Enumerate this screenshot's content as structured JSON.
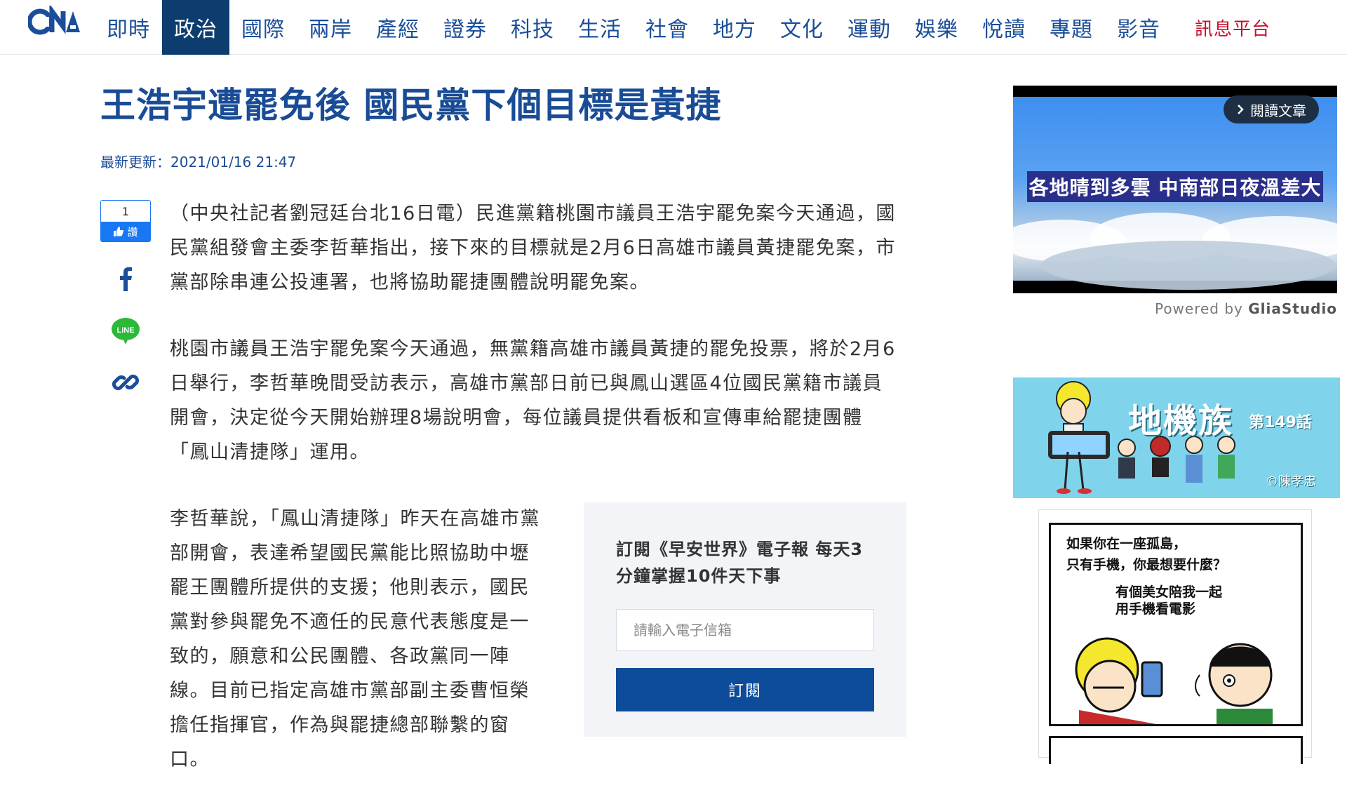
{
  "nav": {
    "logo_text": "CNA",
    "items": [
      {
        "label": "即時"
      },
      {
        "label": "政治"
      },
      {
        "label": "國際"
      },
      {
        "label": "兩岸"
      },
      {
        "label": "產經"
      },
      {
        "label": "證券"
      },
      {
        "label": "科技"
      },
      {
        "label": "生活"
      },
      {
        "label": "社會"
      },
      {
        "label": "地方"
      },
      {
        "label": "文化"
      },
      {
        "label": "運動"
      },
      {
        "label": "娛樂"
      },
      {
        "label": "悅讀"
      },
      {
        "label": "專題"
      },
      {
        "label": "影音"
      }
    ],
    "active": "政治",
    "special_item": "訊息平台",
    "colors": {
      "link": "#1b4e9a",
      "active_bg": "#0d3c6e",
      "special": "#c8102e"
    }
  },
  "article": {
    "headline": "王浩宇遭罷免後 國民黨下個目標是黃捷",
    "updated_label": "最新更新：",
    "updated_time": "2021/01/16 21:47",
    "paragraphs": [
      "（中央社記者劉冠廷台北16日電）民進黨籍桃園市議員王浩宇罷免案今天通過，國民黨組發會主委李哲華指出，接下來的目標就是2月6日高雄市議員黃捷罷免案，市黨部除串連公投連署，也將協助罷捷團體說明罷免案。",
      "桃園市議員王浩宇罷免案今天通過，無黨籍高雄市議員黃捷的罷免投票，將於2月6日舉行，李哲華晚間受訪表示，高雄市黨部日前已與鳳山選區4位國民黨籍市議員開會，決定從今天開始辦理8場說明會，每位議員提供看板和宣傳車給罷捷團體「鳳山清捷隊」運用。",
      "李哲華說，「鳳山清捷隊」昨天在高雄市黨部開會，表達希望國民黨能比照協助中壢罷王團體所提供的支援；他則表示，國民黨對參與罷免不適任的民意代表態度是一致的，願意和公民團體、各政黨同一陣線。目前已指定高雄市黨部副主委曹恒榮擔任指揮官，作為與罷捷總部聯繫的窗口。"
    ]
  },
  "share": {
    "like_count": "1",
    "like_label": "讚",
    "icons": [
      "facebook-icon",
      "line-icon",
      "link-icon"
    ],
    "line_label": "LINE"
  },
  "newsletter": {
    "title": "訂閱《早安世界》電子報 每天3分鐘掌握10件天下事",
    "email_placeholder": "請輸入電子信箱",
    "subscribe_label": "訂閱"
  },
  "sidebar": {
    "video": {
      "read_article_label": "閱讀文章",
      "caption": "各地晴到多雲 中南部日夜溫差大",
      "powered_prefix": "Powered by ",
      "powered_brand": "GliaStudio"
    },
    "comic_banner": {
      "title": "地機族",
      "episode": "第149話",
      "credit": "©陳孝忠"
    },
    "comic_strip": {
      "bubble_1_line_1": "如果你在一座孤島，",
      "bubble_1_line_2": "只有手機，你最想要什麼？",
      "bubble_2_line_1": "有個美女陪我一起",
      "bubble_2_line_2": "用手機看電影"
    }
  }
}
